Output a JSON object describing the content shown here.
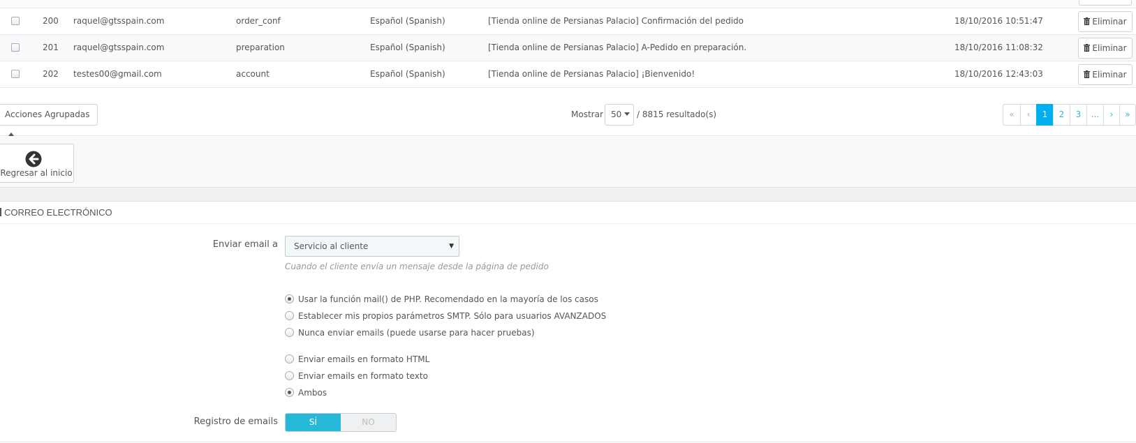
{
  "table": {
    "rows": [
      {
        "id": "200",
        "email": "raquel@gtsspain.com",
        "template": "order_conf",
        "language": "Español (Spanish)",
        "subject": "[Tienda online de Persianas Palacio] Confirmación del pedido",
        "date": "18/10/2016 10:51:47",
        "delete_label": "Eliminar"
      },
      {
        "id": "201",
        "email": "raquel@gtsspain.com",
        "template": "preparation",
        "language": "Español (Spanish)",
        "subject": "[Tienda online de Persianas Palacio] A-Pedido en preparación.",
        "date": "18/10/2016 11:08:32",
        "delete_label": "Eliminar"
      },
      {
        "id": "202",
        "email": "testes00@gmail.com",
        "template": "account",
        "language": "Español (Spanish)",
        "subject": "[Tienda online de Persianas Palacio] ¡Bienvenido!",
        "date": "18/10/2016 12:43:03",
        "delete_label": "Eliminar"
      }
    ]
  },
  "list_footer": {
    "bulk_actions_label": "Acciones Agrupadas",
    "show_label": "Mostrar",
    "per_page": "50",
    "results_text": "/ 8815 resultado(s)",
    "pagination": [
      "«",
      "‹",
      "1",
      "2",
      "3",
      "...",
      "›",
      "»"
    ],
    "active_page": "1"
  },
  "back": {
    "label": "Regresar al inicio"
  },
  "email_panel": {
    "heading": "CORREO ELECTRÓNICO",
    "send_to_label": "Enviar email a",
    "send_to_value": "Servicio al cliente",
    "send_to_help": "Cuando el cliente envía un mensaje desde la página de pedido",
    "method_options": [
      {
        "label": "Usar la función mail() de PHP. Recomendado en la mayoría de los casos",
        "selected": true
      },
      {
        "label": "Establecer mis propios parámetros SMTP. Sólo para usuarios AVANZADOS",
        "selected": false
      },
      {
        "label": "Nunca enviar emails (puede usarse para hacer pruebas)",
        "selected": false
      }
    ],
    "format_options": [
      {
        "label": "Enviar emails en formato HTML",
        "selected": false
      },
      {
        "label": "Enviar emails en formato texto",
        "selected": false
      },
      {
        "label": "Ambos",
        "selected": true
      }
    ],
    "log_label": "Registro de emails",
    "log_yes": "SÍ",
    "log_no": "NO"
  },
  "colors": {
    "accent": "#25b9d7",
    "active_page": "#00aff0"
  }
}
